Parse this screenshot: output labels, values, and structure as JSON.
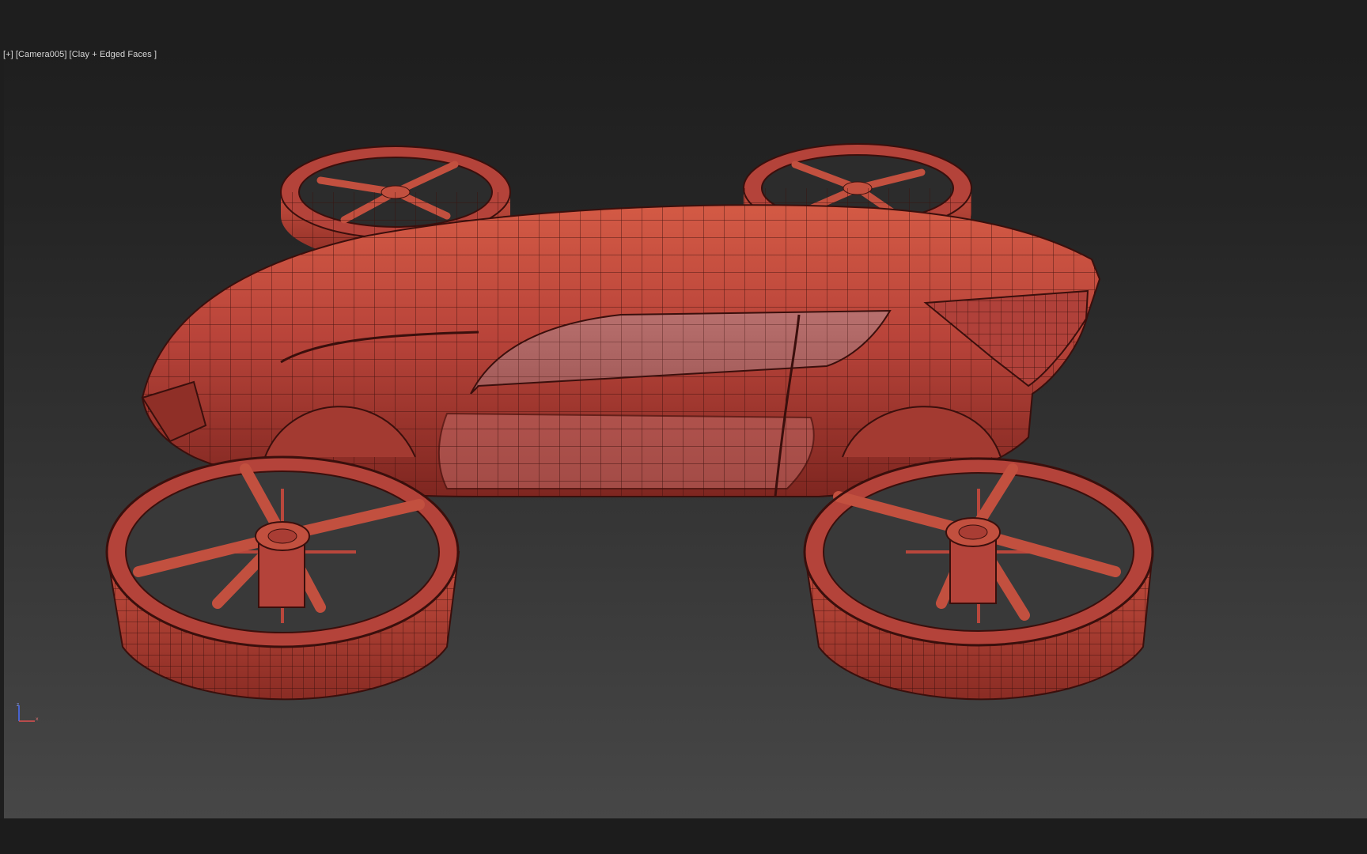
{
  "viewport": {
    "label": {
      "menu": "[+]",
      "camera": "[Camera005]",
      "shading": "[Clay + Edged Faces ]"
    },
    "model": "flying-car-quad-fan-wireframe",
    "clay_color": "#c0483a",
    "edge_color": "#3a0f0c",
    "gizmo": {
      "z_color": "#4a6fff",
      "x_color": "#e05050"
    }
  }
}
